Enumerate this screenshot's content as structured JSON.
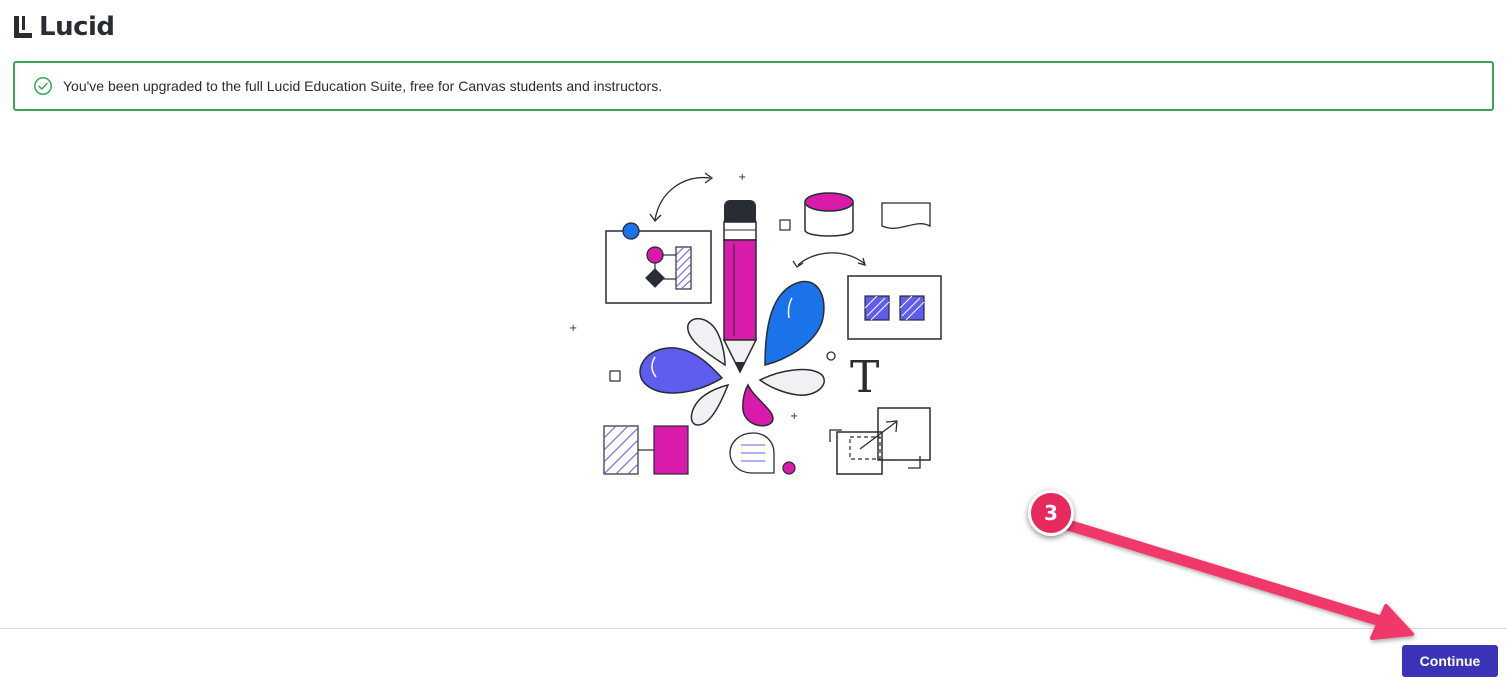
{
  "header": {
    "logo_text": "Lucid"
  },
  "banner": {
    "message": "You've been upgraded to the full Lucid Education Suite, free for Canvas students and instructors.",
    "icon": "check-circle-icon",
    "border_color": "#3aa655"
  },
  "illustration": {
    "text_glyph": "T"
  },
  "footer": {
    "continue_label": "Continue",
    "button_color": "#3a33b7"
  },
  "annotation": {
    "step_number": "3",
    "color": "#e8295e"
  },
  "colors": {
    "magenta": "#d91bab",
    "blue": "#1a73e8",
    "violet": "#5f5cf0",
    "dark": "#282c33"
  }
}
